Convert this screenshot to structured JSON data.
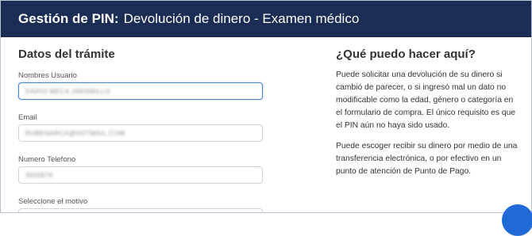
{
  "header": {
    "strong": "Gestión de PIN:",
    "rest": "Devolución de dinero - Examen médico"
  },
  "form": {
    "title": "Datos del trámite",
    "fields": [
      {
        "label": "Nombres Usuario",
        "value": "DARIO MECA JARAMILLO"
      },
      {
        "label": "Email",
        "value": "RUBENARCA@HOTMAIL.COM"
      },
      {
        "label": "Numero Telefono",
        "value": "3000876"
      },
      {
        "label": "Seleccione el motivo",
        "value": ""
      }
    ]
  },
  "help": {
    "title": "¿Qué puedo hacer aquí?",
    "paragraphs": [
      "Puede solicitar una devolución de su dinero si cambió de parecer, o si ingresó mal un dato no modificable como la edad, género o categoría en el formulario de compra. El único requisito es que el PIN aún no haya sido usado.",
      "Puede escoger recibir su dinero por medio de una transferencia electrónica, o por efectivo en un punto de atención de Punto de Pago."
    ]
  },
  "colors": {
    "header_bg": "#1b2c55",
    "focus_border": "#4f86d8",
    "fab": "#1f6ad6"
  },
  "icons": {
    "fab": "chat-icon"
  }
}
